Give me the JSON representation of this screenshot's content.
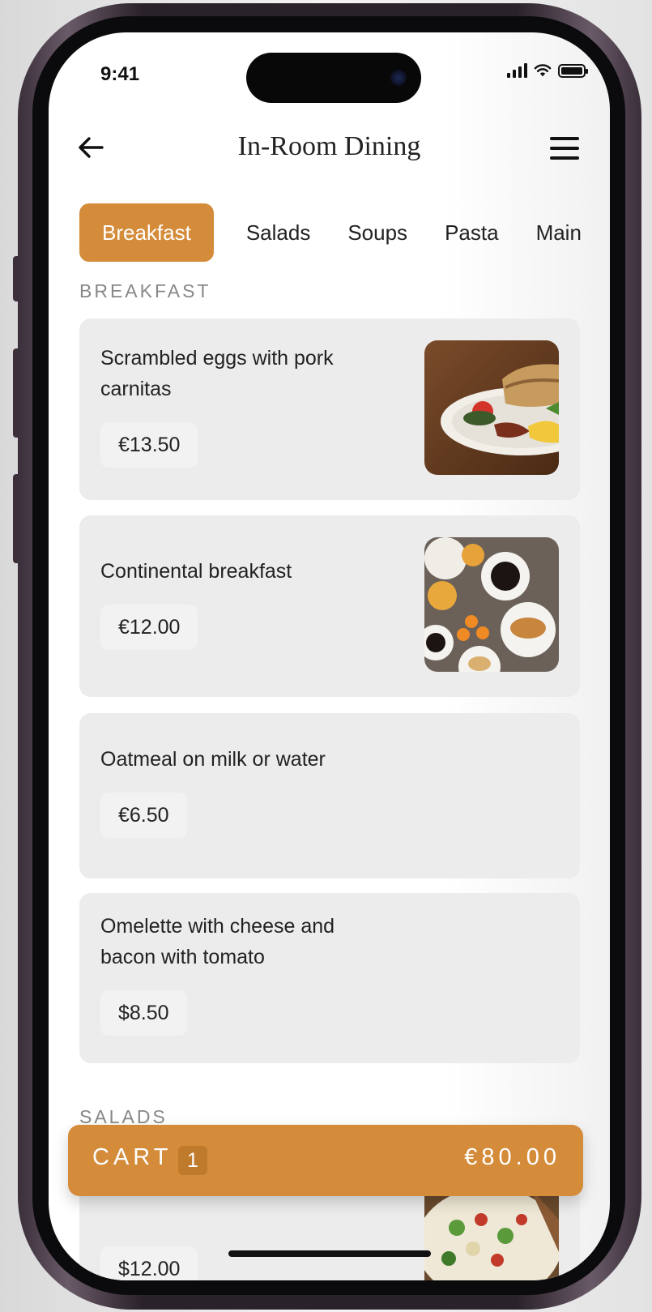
{
  "status_bar": {
    "time": "9:41"
  },
  "header": {
    "title": "In-Room Dining"
  },
  "tabs": [
    {
      "label": "Breakfast",
      "active": true
    },
    {
      "label": "Salads",
      "active": false
    },
    {
      "label": "Soups",
      "active": false
    },
    {
      "label": "Pasta",
      "active": false
    },
    {
      "label": "Main",
      "active": false
    }
  ],
  "sections": [
    {
      "label": "BREAKFAST",
      "items": [
        {
          "name": "Scrambled eggs with pork carnitas",
          "price": "€13.50",
          "image": "breakfast-plate-photo"
        },
        {
          "name": "Continental breakfast",
          "price": "€12.00",
          "image": "continental-breakfast-photo"
        },
        {
          "name": "Oatmeal on milk or water",
          "price": "€6.50"
        },
        {
          "name": "Omelette with cheese and bacon with tomato",
          "price": "$8.50"
        }
      ]
    },
    {
      "label": "SALADS",
      "items": [
        {
          "price": "$12.00",
          "image": "salad-photo"
        }
      ]
    }
  ],
  "cart": {
    "label": "CART",
    "count": "1",
    "total": "€80.00"
  },
  "colors": {
    "accent": "#d48c3a",
    "card_bg": "#ececec",
    "chip_bg": "#f2f2f2"
  }
}
